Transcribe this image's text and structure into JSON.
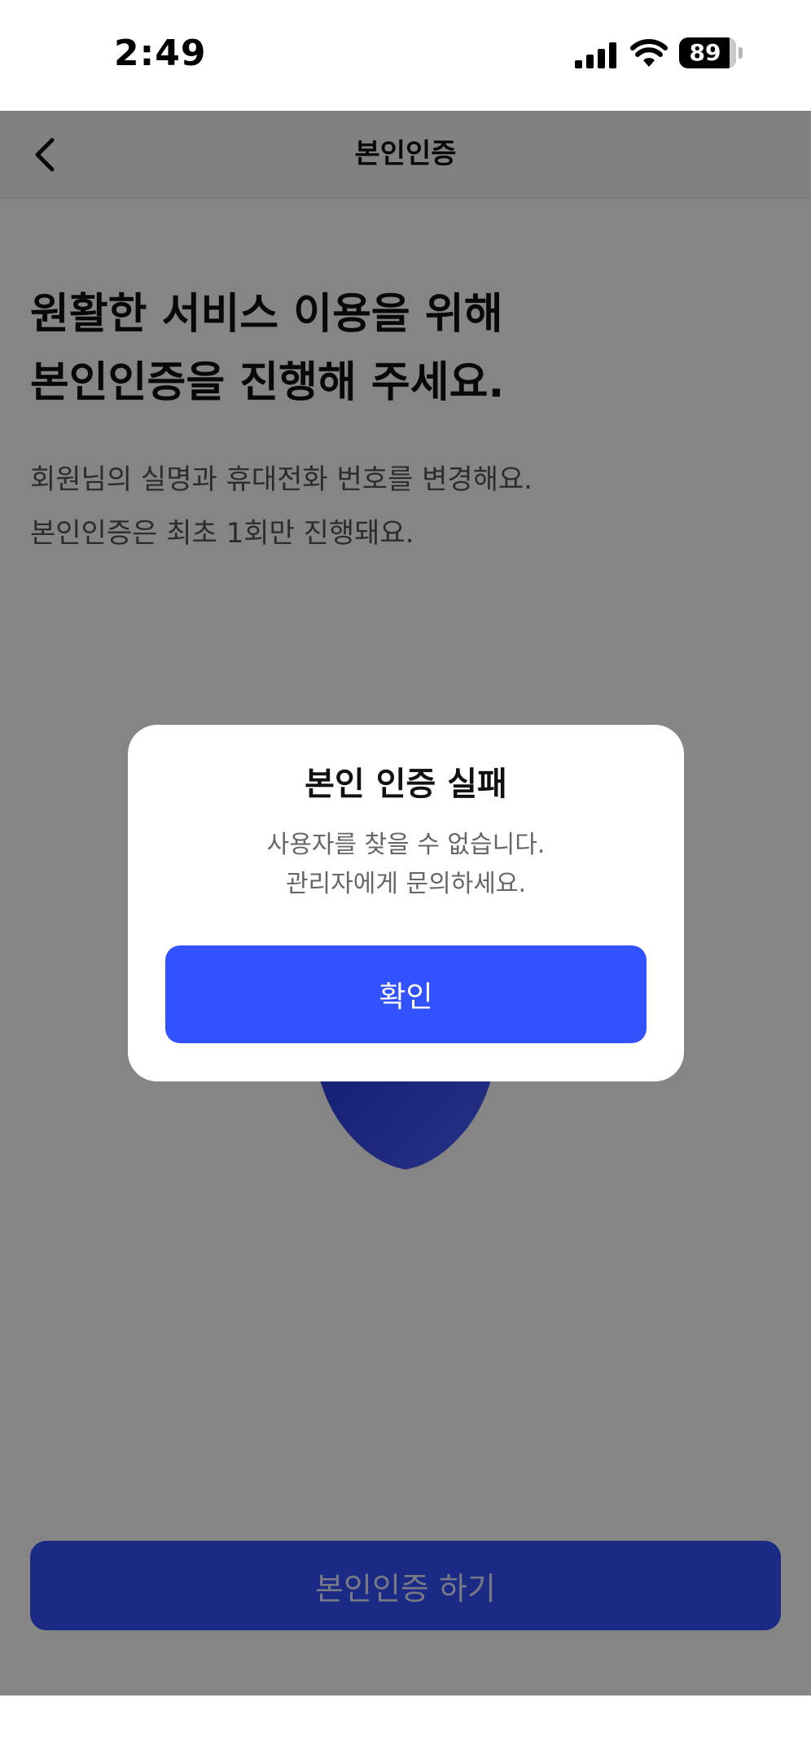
{
  "status_bar": {
    "time": "2:49",
    "battery_level": "89",
    "battery_fraction": 0.89,
    "icons": [
      "signal-icon",
      "wifi-icon",
      "battery-icon"
    ]
  },
  "nav": {
    "title": "본인인증",
    "back_icon": "chevron-left-icon"
  },
  "main": {
    "headline_lines": [
      "원활한 서비스 이용을 위해",
      "본인인증을 진행해 주세요."
    ],
    "description_lines": [
      "회원님의 실명과 휴대전화 번호를 변경해요.",
      "본인인증은 최초 1회만 진행돼요."
    ],
    "illustration_icon": "shield-icon",
    "cta_label": "본인인증 하기"
  },
  "dialog": {
    "title": "본인 인증 실패",
    "message_lines": [
      "사용자를 찾을 수 없습니다.",
      "관리자에게 문의하세요."
    ],
    "confirm_label": "확인"
  },
  "colors": {
    "accent": "#3251FF",
    "overlay": "rgba(0,0,0,0.48)",
    "dialog_bg": "#FFFFFF"
  }
}
